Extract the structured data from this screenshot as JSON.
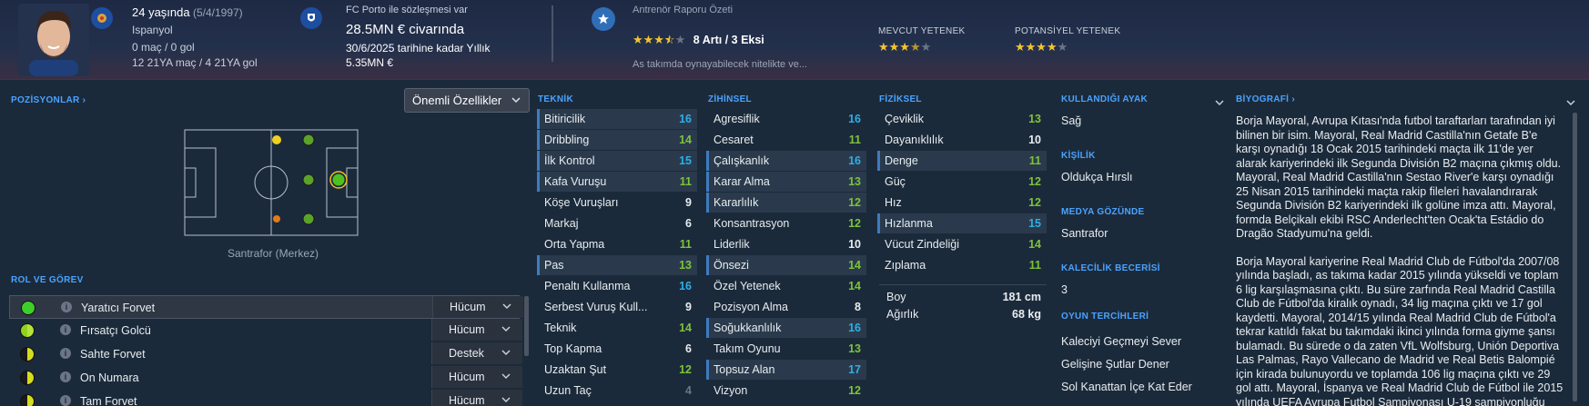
{
  "header": {
    "age_line": "24 yaşında",
    "birth_date": "(5/4/1997)",
    "club": "Ispanyol",
    "caps": "0 maç / 0 gol",
    "u21": "12 21YA maç / 4 21YA gol",
    "contract_label": "FC Porto ile sözleşmesi var",
    "value": "28.5MN € civarında",
    "contract_until": "30/6/2025 tarihine kadar Yıllık",
    "wage": "5.35MN €",
    "report_title": "Antrenör Raporu Özeti",
    "report_summary": "8 Artı / 3 Eksi",
    "report_note": "As takımda oynayabilecek nitelikte ve...",
    "current_ability_label": "MEVCUT YETENEK",
    "potential_ability_label": "POTANSİYEL YETENEK",
    "report_stars": 3.5,
    "current_stars": 3.5,
    "potential_stars": 4
  },
  "left": {
    "positions_title": "POZİSYONLAR",
    "dropdown_label": "Önemli Özellikler",
    "position_label": "Santrafor (Merkez)",
    "roles_title": "ROL VE GÖREV",
    "roles": [
      {
        "name": "Yaratıcı Forvet",
        "duty": "Hücum",
        "rating": "full"
      },
      {
        "name": "Fırsatçı Golcü",
        "duty": "Hücum",
        "rating": "half"
      },
      {
        "name": "Sahte Forvet",
        "duty": "Destek",
        "rating": "half-dark"
      },
      {
        "name": "On Numara",
        "duty": "Hücum",
        "rating": "half-dark"
      },
      {
        "name": "Tam Forvet",
        "duty": "Hücum",
        "rating": "half-dark"
      }
    ]
  },
  "technical": {
    "title": "TEKNİK",
    "attrs": [
      {
        "name": "Bitiricilik",
        "value": "16",
        "hl": true
      },
      {
        "name": "Dribbling",
        "value": "14",
        "hl": true
      },
      {
        "name": "İlk Kontrol",
        "value": "15",
        "hl": true
      },
      {
        "name": "Kafa Vuruşu",
        "value": "11",
        "hl": true
      },
      {
        "name": "Köşe Vuruşları",
        "value": "9",
        "hl": false
      },
      {
        "name": "Markaj",
        "value": "6",
        "hl": false
      },
      {
        "name": "Orta Yapma",
        "value": "11",
        "hl": false
      },
      {
        "name": "Pas",
        "value": "13",
        "hl": true
      },
      {
        "name": "Penaltı Kullanma",
        "value": "16",
        "hl": false
      },
      {
        "name": "Serbest Vuruş Kull...",
        "value": "9",
        "hl": false
      },
      {
        "name": "Teknik",
        "value": "14",
        "hl": false
      },
      {
        "name": "Top Kapma",
        "value": "6",
        "hl": false
      },
      {
        "name": "Uzaktan Şut",
        "value": "12",
        "hl": false
      },
      {
        "name": "Uzun Taç",
        "value": "4",
        "hl": false
      }
    ]
  },
  "mental": {
    "title": "ZİHİNSEL",
    "attrs": [
      {
        "name": "Agresiflik",
        "value": "16",
        "hl": false
      },
      {
        "name": "Cesaret",
        "value": "11",
        "hl": false
      },
      {
        "name": "Çalışkanlık",
        "value": "16",
        "hl": true
      },
      {
        "name": "Karar Alma",
        "value": "13",
        "hl": true
      },
      {
        "name": "Kararlılık",
        "value": "12",
        "hl": true
      },
      {
        "name": "Konsantrasyon",
        "value": "12",
        "hl": false
      },
      {
        "name": "Liderlik",
        "value": "10",
        "hl": false
      },
      {
        "name": "Önsezi",
        "value": "14",
        "hl": true
      },
      {
        "name": "Özel Yetenek",
        "value": "14",
        "hl": false
      },
      {
        "name": "Pozisyon Alma",
        "value": "8",
        "hl": false
      },
      {
        "name": "Soğukkanlılık",
        "value": "16",
        "hl": true
      },
      {
        "name": "Takım Oyunu",
        "value": "13",
        "hl": false
      },
      {
        "name": "Topsuz Alan",
        "value": "17",
        "hl": true
      },
      {
        "name": "Vizyon",
        "value": "12",
        "hl": false
      }
    ]
  },
  "physical": {
    "title": "FİZİKSEL",
    "attrs": [
      {
        "name": "Çeviklik",
        "value": "13",
        "hl": false
      },
      {
        "name": "Dayanıklılık",
        "value": "10",
        "hl": false
      },
      {
        "name": "Denge",
        "value": "11",
        "hl": true
      },
      {
        "name": "Güç",
        "value": "12",
        "hl": false
      },
      {
        "name": "Hız",
        "value": "12",
        "hl": false
      },
      {
        "name": "Hızlanma",
        "value": "15",
        "hl": true
      },
      {
        "name": "Vücut Zindeliği",
        "value": "14",
        "hl": false
      },
      {
        "name": "Zıplama",
        "value": "11",
        "hl": false
      }
    ],
    "height_label": "Boy",
    "height": "181 cm",
    "weight_label": "Ağırlık",
    "weight": "68 kg"
  },
  "info": {
    "foot_title": "KULLANDIĞI AYAK",
    "foot": "Sağ",
    "personality_title": "KİŞİLİK",
    "personality": "Oldukça Hırslı",
    "media_title": "MEDYA GÖZÜNDE",
    "media": "Santrafor",
    "gk_title": "KALECİLİK BECERİSİ",
    "gk": "3",
    "traits_title": "OYUN TERCİHLERİ",
    "traits": [
      "Kaleciyi Geçmeyi Sever",
      "Gelişine Şutlar Dener",
      "Sol Kanattan İçe Kat Eder"
    ]
  },
  "bio": {
    "title": "BİYOGRAFİ",
    "p1": "Borja Mayoral, Avrupa Kıtası'nda futbol taraftarları tarafından iyi bilinen bir isim. Mayoral, Real Madrid Castilla'nın Getafe B'e karşı oynadığı 18 Ocak 2015 tarihindeki maçta ilk 11'de yer alarak kariyerindeki ilk Segunda División B2 maçına çıkmış oldu. Mayoral, Real Madrid Castilla'nın Sestao River'e karşı oynadığı 25 Nisan 2015 tarihindeki maçta rakip fileleri havalandırarak Segunda División B2 kariyerindeki ilk golüne imza attı. Mayoral, formda Belçikalı ekibi RSC Anderlecht'ten Ocak'ta Estádio do Dragão Stadyumu'na geldi.",
    "p2": "Borja Mayoral kariyerine Real Madrid Club de Fútbol'da 2007/08 yılında başladı, as takıma kadar 2015 yılında yükseldi ve toplam 6 lig karşılaşmasına çıktı. Bu süre zarfında Real Madrid Castilla Club de Fútbol'da kiralık oynadı, 34 lig maçına çıktı ve 17 gol kaydetti. Mayoral, 2014/15 yılında Real Madrid Club de Fútbol'a tekrar katıldı fakat bu takımdaki ikinci yılında forma giyme şansı bulamadı. Bu sürede o da zaten VfL Wolfsburg, Unión Deportiva Las Palmas, Rayo Vallecano de Madrid ve Real Betis Balompié için kirada bulunuyordu ve toplamda 106 lig maçına çıktı ve 29 gol attı. Mayoral, İspanya ve Real Madrid Club de Fútbol ile 2015 yılında UEFA Avrupa Futbol Şampiyonası U-19 şampiyonluğu"
  },
  "colors": {
    "accent": "#4aa3ff",
    "value_blue": "#2eaee6",
    "value_green": "#7cc33b",
    "star": "#f4c430"
  }
}
